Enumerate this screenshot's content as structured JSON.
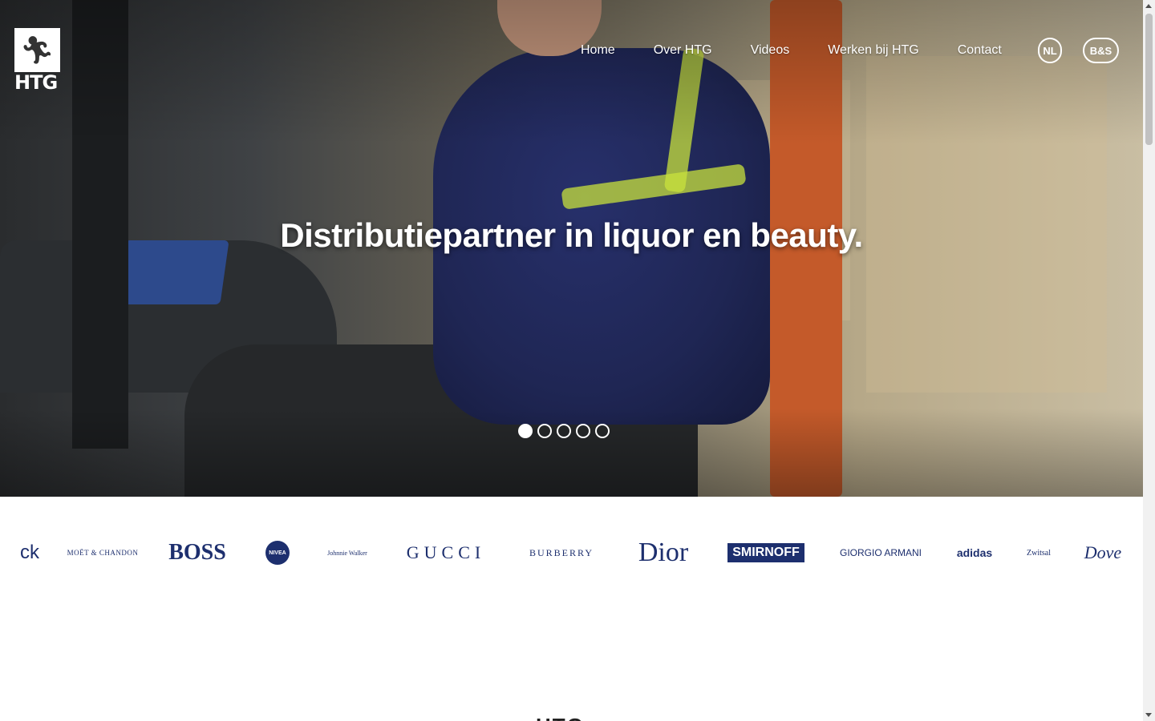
{
  "brand": {
    "logo_text": "HTG",
    "logo_icon": "runner-icon"
  },
  "nav": {
    "items": [
      "Home",
      "Over HTG",
      "Videos",
      "Werken bij HTG",
      "Contact"
    ],
    "lang_label": "NL",
    "bs_label": "B&S"
  },
  "hero": {
    "headline": "Distributiepartner in liquor en beauty.",
    "slide_count": 5,
    "active_slide": 1
  },
  "brands": {
    "logos": [
      "ck",
      "MOËT & CHANDON",
      "BOSS",
      "NIVEA",
      "Johnnie Walker",
      "GUCCI",
      "BURBERRY",
      "Dior",
      "SMIRNOFF",
      "GIORGIO ARMANI",
      "adidas",
      "Zwitsal",
      "Dove"
    ]
  },
  "section_peek": "HTG",
  "colors": {
    "brand_navy": "#1d2f6e",
    "hero_text": "#ffffff"
  }
}
